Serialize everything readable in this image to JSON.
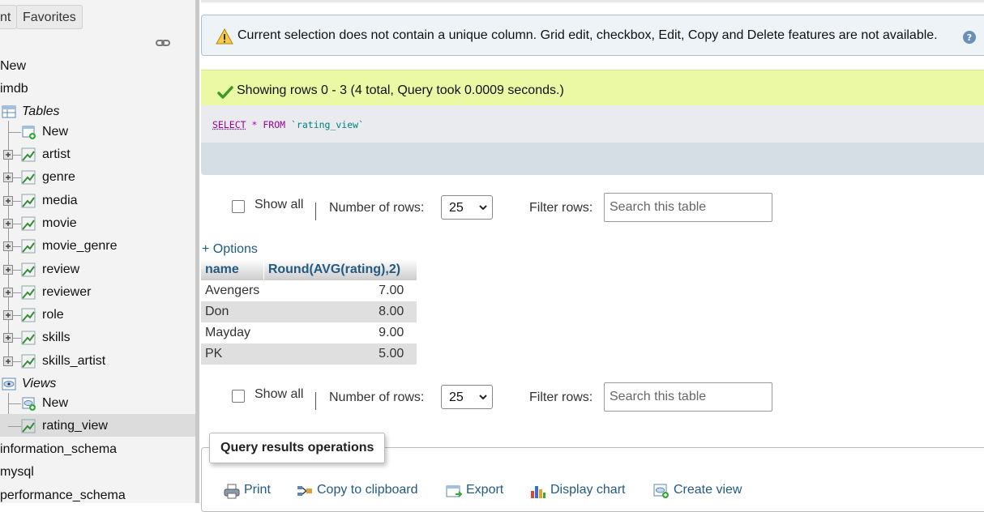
{
  "sidebar": {
    "top_buttons": [
      "nt",
      "Favorites"
    ],
    "tree": {
      "new_db": "New",
      "db": "imdb",
      "tables_group": "Tables",
      "tables_new": "New",
      "tables": [
        "artist",
        "genre",
        "media",
        "movie",
        "movie_genre",
        "review",
        "reviewer",
        "role",
        "skills",
        "skills_artist"
      ],
      "views_group": "Views",
      "views_new": "New",
      "views": [
        "rating_view"
      ],
      "other_dbs": [
        "information_schema",
        "mysql",
        "performance_schema"
      ]
    }
  },
  "main": {
    "warning_text": "Current selection does not contain a unique column. Grid edit, checkbox, Edit, Copy and Delete features are not available.",
    "success_text": "Showing rows 0 - 3 (4 total, Query took 0.0009 seconds.)",
    "sql": {
      "select": "SELECT",
      "star": "*",
      "from": "FROM",
      "table": "`rating_view`"
    },
    "nav": {
      "show_all": "Show all",
      "rows_label": "Number of rows:",
      "rows_value": "25",
      "filter_label": "Filter rows:",
      "filter_placeholder": "Search this table"
    },
    "options_link": "+ Options",
    "table": {
      "columns": [
        "name",
        "Round(AVG(rating),2)"
      ],
      "rows": [
        [
          "Avengers",
          "7.00"
        ],
        [
          "Don",
          "8.00"
        ],
        [
          "Mayday",
          "9.00"
        ],
        [
          "PK",
          "5.00"
        ]
      ]
    },
    "operations": {
      "legend": "Query results operations",
      "links": [
        "Print",
        "Copy to clipboard",
        "Export",
        "Display chart",
        "Create view"
      ]
    }
  },
  "colors": {
    "link": "#235a81",
    "success_bg": "#ebf8a4",
    "warning_bg": "#eef3f8"
  }
}
